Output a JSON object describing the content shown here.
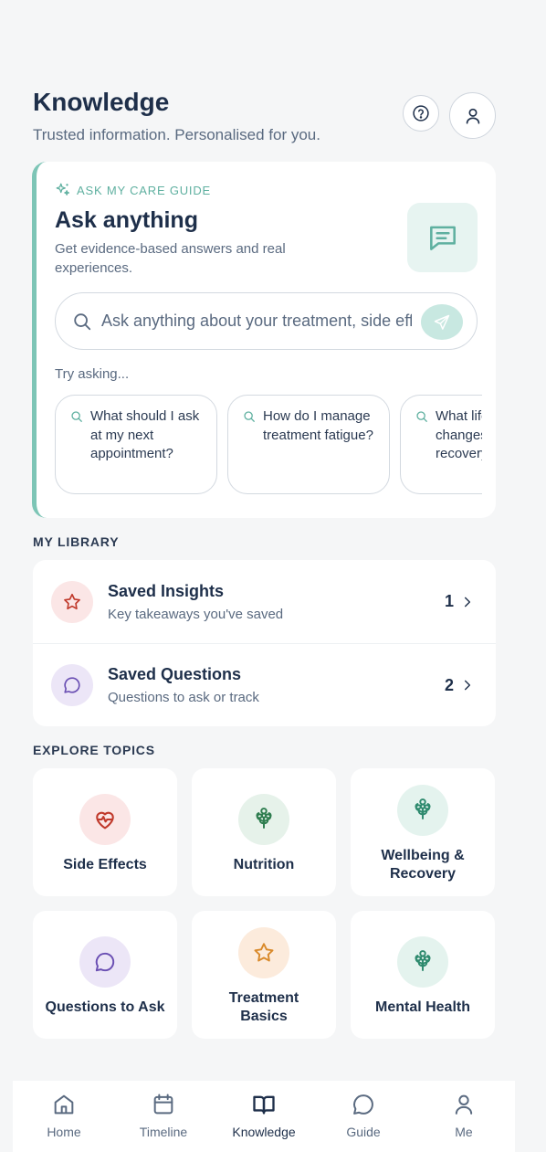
{
  "header": {
    "title": "Knowledge",
    "subtitle": "Trusted information. Personalised for you."
  },
  "ask": {
    "eyebrow": "ASK MY CARE GUIDE",
    "title": "Ask anything",
    "description": "Get evidence-based answers and real experiences.",
    "search_placeholder": "Ask anything about your treatment, side effects...",
    "try_label": "Try asking...",
    "suggestions": [
      "What should I ask at my next appointment?",
      "How do I manage treatment fatigue?",
      "What lifestyle changes help recovery?"
    ]
  },
  "library": {
    "section_label": "MY LIBRARY",
    "items": [
      {
        "title": "Saved Insights",
        "subtitle": "Key takeaways you've saved",
        "count": "1",
        "icon": "star-icon"
      },
      {
        "title": "Saved Questions",
        "subtitle": "Questions to ask or track",
        "count": "2",
        "icon": "chat-bubble-icon"
      }
    ]
  },
  "topics": {
    "section_label": "EXPLORE TOPICS",
    "items": [
      {
        "label": "Side Effects",
        "icon": "heart-pulse-icon",
        "color": "#c0392b"
      },
      {
        "label": "Nutrition",
        "icon": "flower-icon",
        "color": "#2e7d4f"
      },
      {
        "label": "Wellbeing & Recovery",
        "icon": "flower-icon",
        "color": "#2e8a6e"
      },
      {
        "label": "Questions to Ask",
        "icon": "chat-bubble-icon",
        "color": "#6a4fb3"
      },
      {
        "label": "Treatment Basics",
        "icon": "star-icon",
        "color": "#d98a2b"
      },
      {
        "label": "Mental Health",
        "icon": "flower-icon",
        "color": "#2e8a6e"
      }
    ]
  },
  "nav": {
    "items": [
      {
        "label": "Home",
        "icon": "home-icon"
      },
      {
        "label": "Timeline",
        "icon": "calendar-icon"
      },
      {
        "label": "Knowledge",
        "icon": "book-icon",
        "active": true
      },
      {
        "label": "Guide",
        "icon": "chat-bubble-icon"
      },
      {
        "label": "Me",
        "icon": "person-icon"
      }
    ]
  },
  "colors": {
    "accent_teal": "#7dc5b6",
    "text_primary": "#1e2f4a",
    "text_secondary": "#5a6a80"
  }
}
